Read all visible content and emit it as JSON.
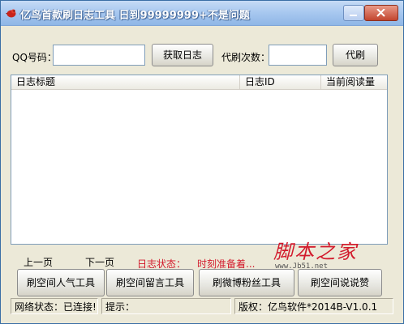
{
  "titlebar": {
    "title": "亿鸟首款刷日志工具   日到99999999+不是问题",
    "icon": "bird-icon"
  },
  "form": {
    "qq_label": "QQ号码：",
    "qq_value": "",
    "fetch_button": "获取日志",
    "count_label": "代刷次数：",
    "count_value": "",
    "run_button": "代刷"
  },
  "list": {
    "columns": [
      "日志标题",
      "日志ID",
      "当前阅读量"
    ],
    "rows": []
  },
  "pager": {
    "prev": "上一页",
    "next": "下一页",
    "status_label": "日志状态：",
    "status_value": "时刻准备着..."
  },
  "tools": {
    "buttons": [
      "刷空间人气工具",
      "刷空间留言工具",
      "刷微博粉丝工具",
      "刷空间说说赞"
    ]
  },
  "statusbar": {
    "network": "网络状态：已连接!",
    "hint": "提示：",
    "version": "版权：亿鸟软件*2014B-V1.0.1"
  },
  "watermark": {
    "text": "脚本之家",
    "url": "www.Jb51.net"
  },
  "colors": {
    "accent_red": "#d21a2c",
    "title_bar": "#a9c9f0"
  }
}
